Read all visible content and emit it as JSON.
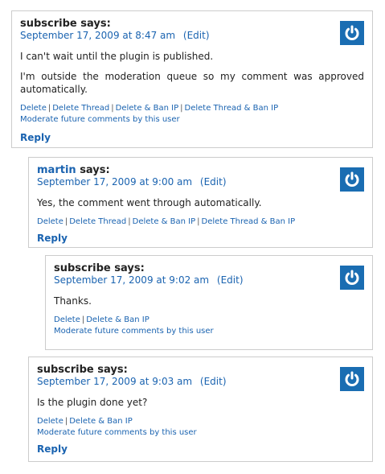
{
  "comments": [
    {
      "author": "subscribe",
      "says": "says:",
      "date": "September 17, 2009 at 8:47 am",
      "edit": "(Edit)",
      "paragraphs": [
        "I can't wait until the plugin is published.",
        "I'm outside the moderation queue so my comment was approved automatically."
      ],
      "actions": [
        "Delete",
        "Delete Thread",
        "Delete & Ban IP",
        "Delete Thread & Ban IP"
      ],
      "moderate": "Moderate future comments by this user",
      "reply": "Reply"
    },
    {
      "author": "martin",
      "says": "says:",
      "date": "September 17, 2009 at 9:00 am",
      "edit": "(Edit)",
      "paragraphs": [
        "Yes, the comment went through automatically."
      ],
      "actions": [
        "Delete",
        "Delete Thread",
        "Delete & Ban IP",
        "Delete Thread & Ban IP"
      ],
      "reply": "Reply"
    },
    {
      "author": "subscribe",
      "says": "says:",
      "date": "September 17, 2009 at 9:02 am",
      "edit": "(Edit)",
      "paragraphs": [
        "Thanks."
      ],
      "actions": [
        "Delete",
        "Delete & Ban IP"
      ],
      "moderate": "Moderate future comments by this user"
    },
    {
      "author": "subscribe",
      "says": "says:",
      "date": "September 17, 2009 at 9:03 am",
      "edit": "(Edit)",
      "paragraphs": [
        "Is the plugin done yet?"
      ],
      "actions": [
        "Delete",
        "Delete & Ban IP"
      ],
      "moderate": "Moderate future comments by this user",
      "reply": "Reply"
    }
  ],
  "colors": {
    "link": "#1a63b0",
    "avatar": "#1a6db2",
    "border": "#cccccc"
  },
  "icons": {
    "avatar": "power-icon"
  }
}
